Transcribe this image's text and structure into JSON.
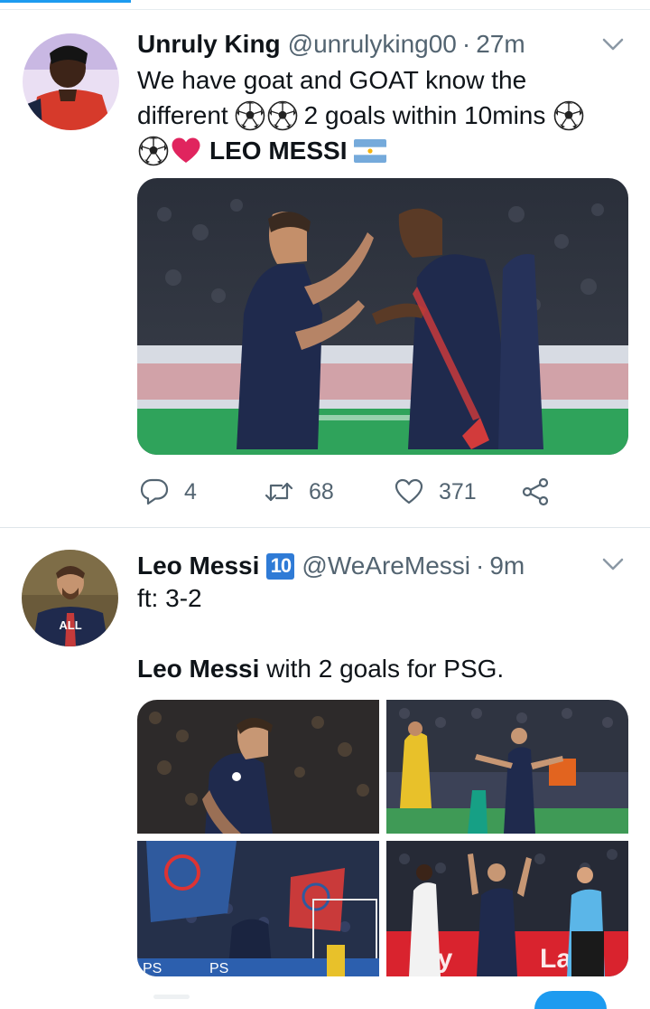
{
  "colors": {
    "accent": "#1d9bf0",
    "text_primary": "#0f1419",
    "text_secondary": "#536471",
    "divider": "#dfe5ea",
    "heart_red": "#e0245e",
    "badge_blue": "#2f7bd6"
  },
  "tweets": [
    {
      "author_name": "Unruly King",
      "handle": "@unrulyking00",
      "separator": "·",
      "time": "27m",
      "text_line_1": "We have goat and GOAT know the",
      "text_line_2_prefix": "different",
      "text_line_2_suffix": "2 goals within 10mins",
      "text_line_3_bold": "LEO MESSI",
      "emojis": [
        "soccer-ball",
        "soccer-ball",
        "soccer-ball",
        "soccer-ball",
        "red-heart",
        "argentina-flag"
      ],
      "media": [
        "photo"
      ],
      "actions": {
        "reply_count": "4",
        "retweet_count": "68",
        "like_count": "371"
      }
    },
    {
      "author_name": "Leo Messi",
      "badge": "10",
      "handle": "@WeAreMessi",
      "separator": "·",
      "time": "9m",
      "text_line_1": "ft: 3-2",
      "text_line_2_bold": "Leo Messi",
      "text_line_2_rest": " with 2 goals for PSG.",
      "media": [
        "photo",
        "photo",
        "photo",
        "photo"
      ]
    }
  ]
}
